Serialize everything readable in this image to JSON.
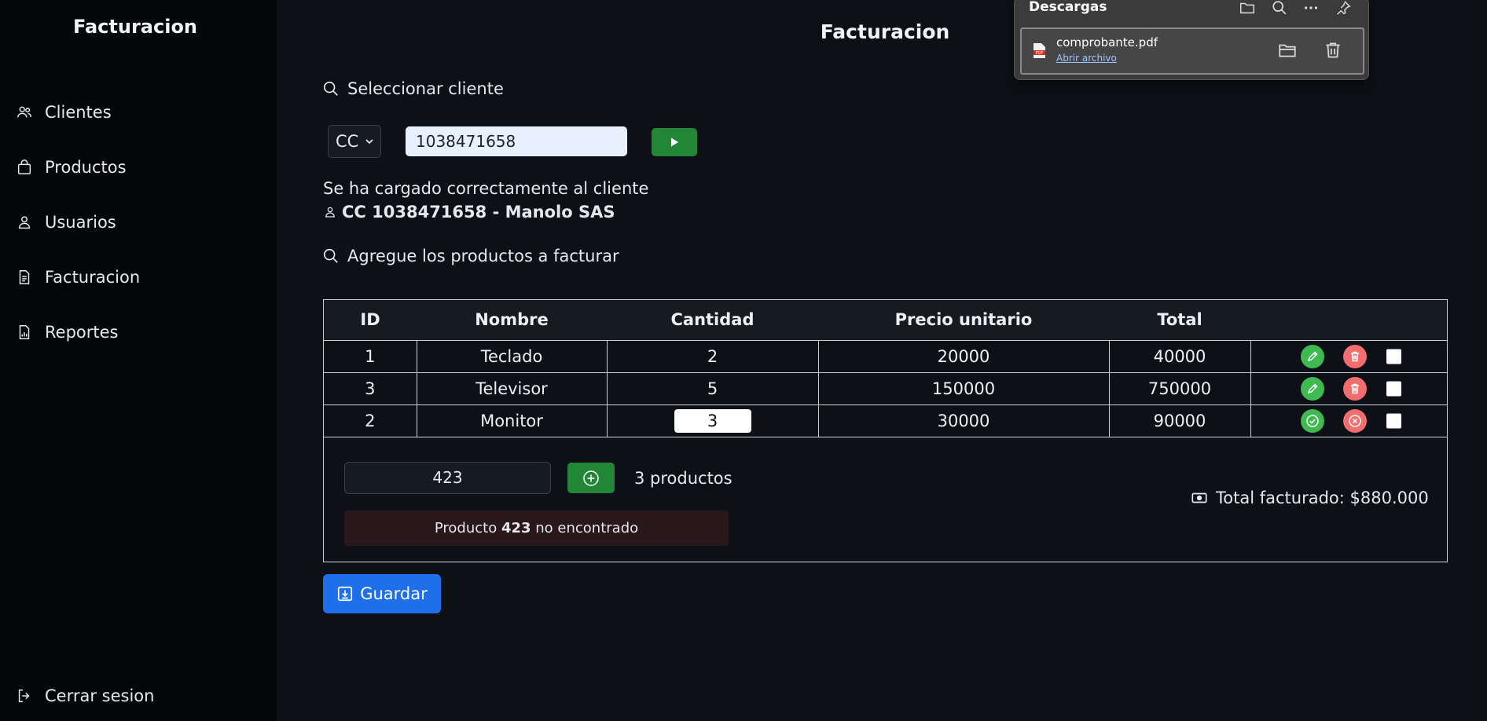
{
  "sidebar": {
    "brand": "Facturacion",
    "items": [
      {
        "label": "Clientes",
        "icon": "users-icon"
      },
      {
        "label": "Productos",
        "icon": "bag-icon"
      },
      {
        "label": "Usuarios",
        "icon": "user-icon"
      },
      {
        "label": "Facturacion",
        "icon": "document-icon"
      },
      {
        "label": "Reportes",
        "icon": "report-icon"
      }
    ],
    "logout": "Cerrar sesion"
  },
  "main": {
    "title": "Facturacion",
    "select_client_label": "Seleccionar cliente",
    "doc_type": "CC",
    "doc_number": "1038471658",
    "client_loaded_msg": "Se ha cargado correctamente al cliente",
    "client_info": "CC 1038471658 - Manolo SAS",
    "add_products_label": "Agregue los productos a facturar"
  },
  "table": {
    "headers": [
      "ID",
      "Nombre",
      "Cantidad",
      "Precio unitario",
      "Total"
    ],
    "rows": [
      {
        "id": "1",
        "name": "Teclado",
        "qty": "2",
        "price": "20000",
        "total": "40000",
        "editing": false
      },
      {
        "id": "3",
        "name": "Televisor",
        "qty": "5",
        "price": "150000",
        "total": "750000",
        "editing": false
      },
      {
        "id": "2",
        "name": "Monitor",
        "qty": "3",
        "price": "30000",
        "total": "90000",
        "editing": true
      }
    ]
  },
  "footer": {
    "product_input": "423",
    "count": "3 productos",
    "error_prefix": "Producto",
    "error_code": "423",
    "error_suffix": "no encontrado",
    "total_label": "Total facturado: $880.000"
  },
  "save_label": "Guardar",
  "downloads": {
    "title": "Descargas",
    "file_name": "comprobante.pdf",
    "open_link": "Abrir archivo"
  },
  "colors": {
    "accent_green": "#238636",
    "edit_green": "#3fb950",
    "delete_red": "#f26d6d",
    "save_blue": "#1f6feb"
  }
}
